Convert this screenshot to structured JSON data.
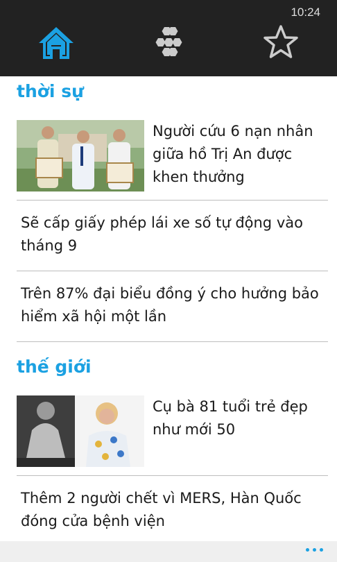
{
  "status": {
    "time": "10:24"
  },
  "nav": {
    "tabs": [
      {
        "icon": "home-icon",
        "active": true
      },
      {
        "icon": "categories-icon",
        "active": false
      },
      {
        "icon": "star-icon",
        "active": false
      }
    ],
    "active_color": "#1ba1e2",
    "inactive_color": "#cccccc"
  },
  "sections": [
    {
      "title": "thời sự",
      "articles": [
        {
          "headline": "Người cứu 6 nạn nhân giữa hồ Trị An được khen thưởng",
          "has_thumbnail": true
        },
        {
          "headline": "Sẽ cấp giấy phép lái xe số tự động vào tháng 9",
          "has_thumbnail": false
        },
        {
          "headline": "Trên 87% đại biểu đồng ý cho hưởng bảo hiểm xã hội một lần",
          "has_thumbnail": false
        }
      ]
    },
    {
      "title": "thế giới",
      "articles": [
        {
          "headline": "Cụ bà 81 tuổi trẻ đẹp như mới 50",
          "has_thumbnail": true
        },
        {
          "headline": "Thêm 2 người chết vì MERS, Hàn Quốc đóng cửa bệnh viện",
          "has_thumbnail": false
        }
      ]
    }
  ],
  "appbar": {
    "more_icon": "more-dots-icon"
  }
}
